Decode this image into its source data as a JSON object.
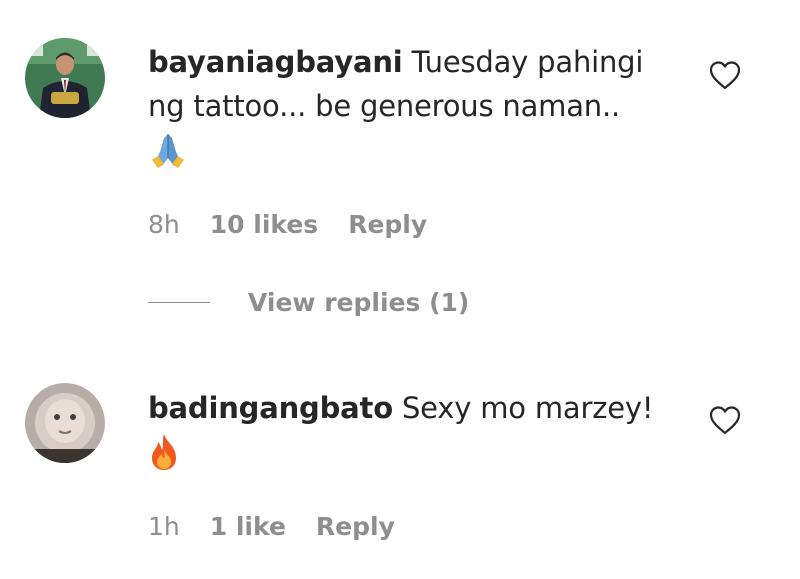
{
  "comments": [
    {
      "username": "bayaniagbayani",
      "text_line1": "Tuesday pahingi",
      "text_line2": "ng tattoo... be generous naman..",
      "emoji": "🙏",
      "emoji_icon": "folded-hands-emoji",
      "time": "8h",
      "likes": "10 likes",
      "reply_label": "Reply"
    },
    {
      "username": "badingangbato",
      "text_line1": "Sexy mo marzey!",
      "emoji": "🔥",
      "emoji_icon": "fire-emoji",
      "time": "1h",
      "likes": "1 like",
      "reply_label": "Reply"
    }
  ],
  "view_replies": {
    "label": "View replies (1)"
  },
  "colors": {
    "text": "#262626",
    "secondary": "#8e8e8e"
  }
}
